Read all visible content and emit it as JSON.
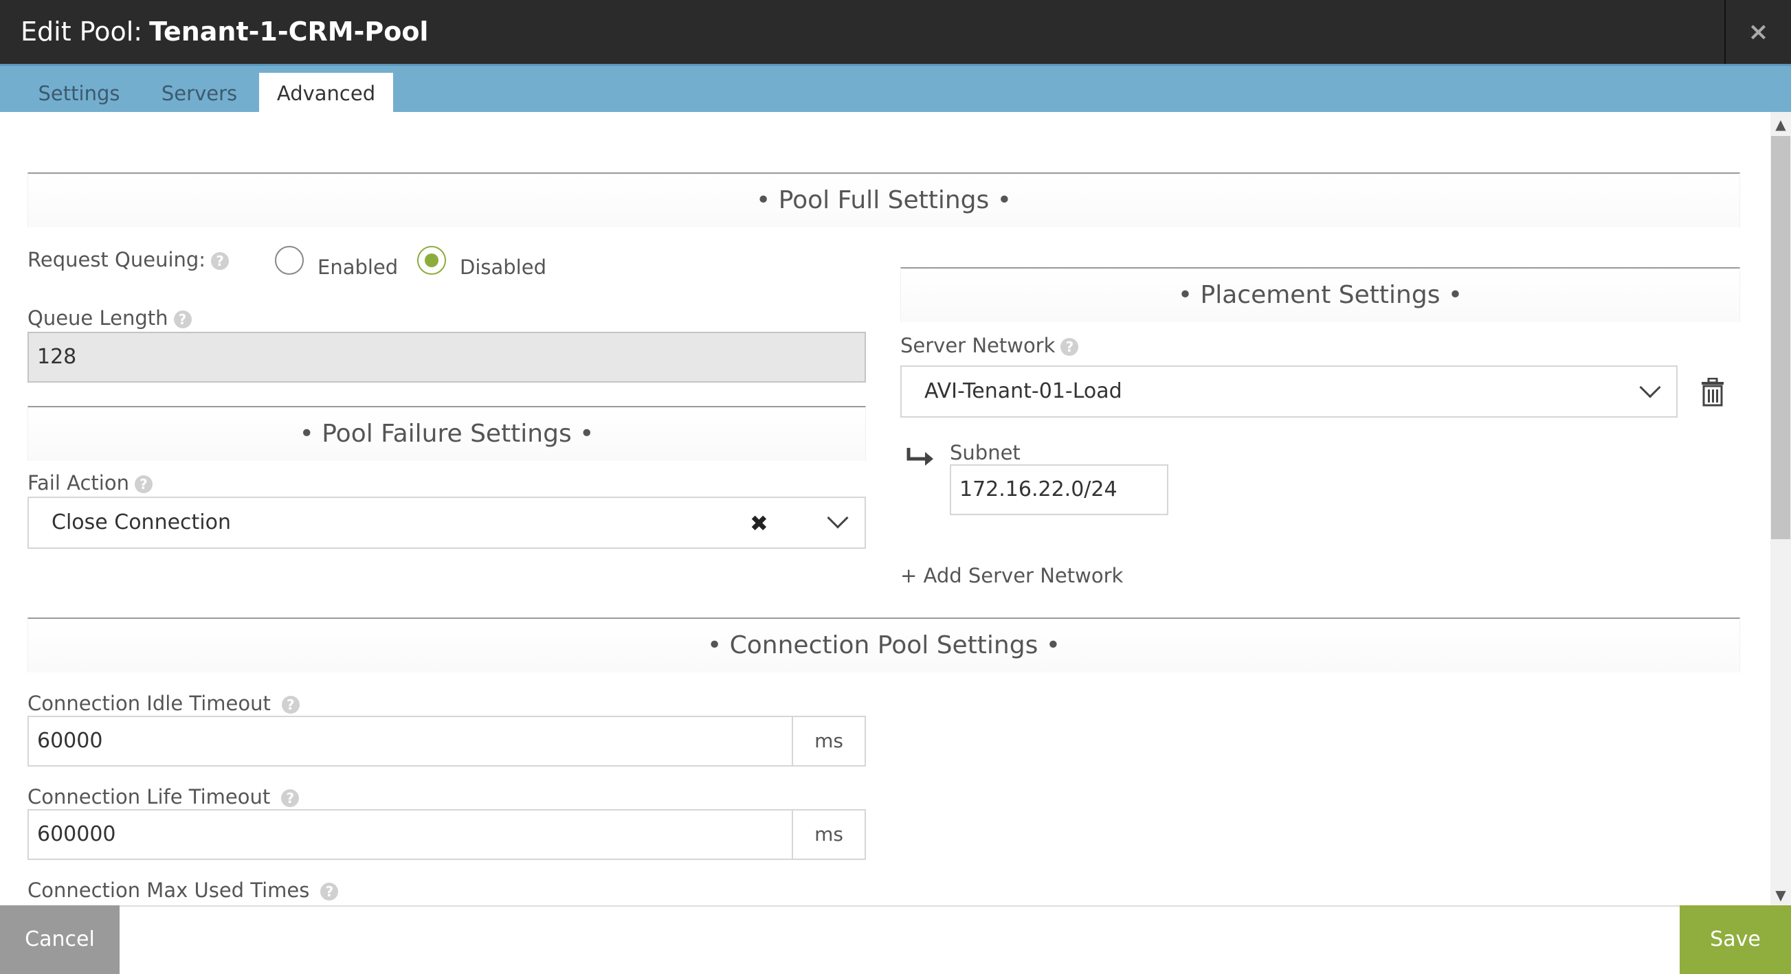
{
  "header": {
    "prefix": "Edit Pool:",
    "pool_name": "Tenant-1-CRM-Pool",
    "close_glyph": "×"
  },
  "tabs": [
    {
      "label": "Settings",
      "active": false
    },
    {
      "label": "Servers",
      "active": false
    },
    {
      "label": "Advanced",
      "active": true
    }
  ],
  "pool_full": {
    "title": "• Pool Full Settings •",
    "request_queuing_label": "Request Queuing:",
    "option_enabled": "Enabled",
    "option_disabled": "Disabled",
    "selected": "Disabled",
    "queue_length_label": "Queue Length",
    "queue_length_value": "128"
  },
  "pool_failure": {
    "title": "• Pool Failure Settings •",
    "fail_action_label": "Fail Action",
    "fail_action_value": "Close Connection"
  },
  "placement": {
    "title": "• Placement Settings •",
    "server_network_label": "Server Network",
    "server_network_value": "AVI-Tenant-01-Load",
    "subnet_label": "Subnet",
    "subnet_value": "172.16.22.0/24",
    "add_network_label": "+ Add Server Network"
  },
  "connection_pool": {
    "title": "• Connection Pool Settings •",
    "idle_timeout_label": "Connection Idle Timeout",
    "idle_timeout_value": "60000",
    "idle_timeout_unit": "ms",
    "life_timeout_label": "Connection Life Timeout",
    "life_timeout_value": "600000",
    "life_timeout_unit": "ms",
    "max_used_label": "Connection Max Used Times"
  },
  "footer": {
    "cancel_label": "Cancel",
    "save_label": "Save"
  },
  "help_glyph": "?",
  "colors": {
    "titlebar": "#2b2b2b",
    "tabbar": "#74aecf",
    "accent_green": "#8fae3e",
    "cancel_gray": "#9a9a9a"
  }
}
